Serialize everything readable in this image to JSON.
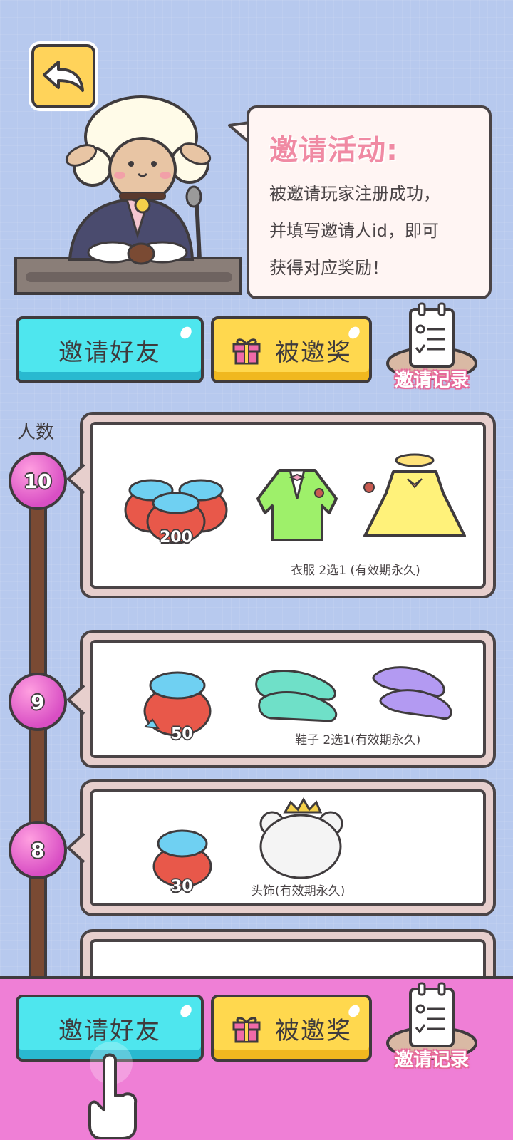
{
  "header": {
    "back_icon": "back-arrow-icon"
  },
  "bubble": {
    "title": "邀请活动:",
    "line1": "被邀请玩家注册成功，",
    "line2": "并填写邀请人id，即可",
    "line3": "获得对应奖励！"
  },
  "actions": {
    "invite_label": "邀请好友",
    "invited_reward_label": "被邀奖",
    "record_label": "邀请记录"
  },
  "milestones": {
    "count_label": "人数",
    "levels": [
      {
        "count": "10",
        "gems": "200",
        "caption": "衣服 2选1 (有效期永久)"
      },
      {
        "count": "9",
        "gems": "50",
        "caption": "鞋子 2选1(有效期永久)"
      },
      {
        "count": "8",
        "gems": "30",
        "caption": "头饰(有效期永久)"
      }
    ]
  },
  "bottom": {
    "invite_label": "邀请好友",
    "invited_reward_label": "被邀奖",
    "record_label": "邀请记录"
  },
  "colors": {
    "background": "#b7c9ee",
    "accent_cyan": "#4ee6ee",
    "accent_yellow": "#ffd84e",
    "accent_pink": "#ef7fd6",
    "title_pink": "#f08aa3"
  }
}
